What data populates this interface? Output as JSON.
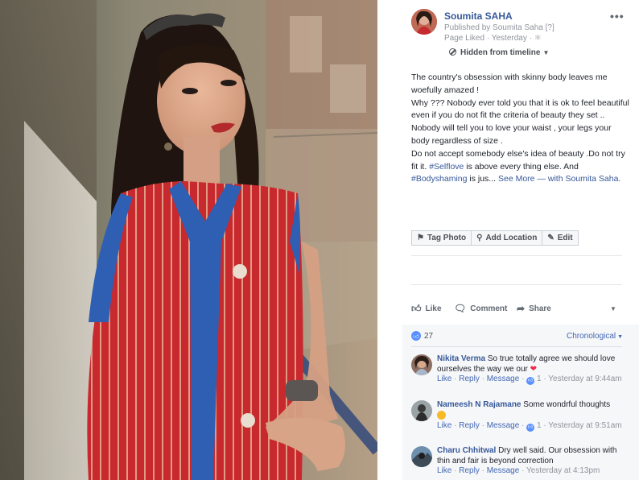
{
  "post": {
    "author": "Soumita SAHA",
    "published_by": "Published by Soumita Saha",
    "help_mark": "[?]",
    "liked_line": "Page Liked · Yesterday ·",
    "more": "•••",
    "visibility": "Hidden from timeline",
    "body": [
      "The country's obsession with skinny body leaves me woefully amazed !",
      "Why ??? Nobody ever told you that it is ok to feel beautiful even if you do not fit the criteria of beauty they set ..",
      "Nobody will tell you to love your waist , your legs your body regardless of size .",
      "Do not accept somebody else's idea of beauty .Do not try fit it."
    ],
    "hashtag_selflove": "#Selflove",
    "after_selflove": " is above every thing else. And ",
    "hashtag_bodyshaming": "#Bodyshaming",
    "after_bodyshaming": " is jus...",
    "see_more": "See More",
    "with_text": "— with",
    "tagged": "Soumita Saha."
  },
  "photo_actions": {
    "tag_photo": "Tag Photo",
    "add_location": "Add Location",
    "edit": "Edit"
  },
  "reactions": {
    "like": "Like",
    "comment": "Comment",
    "share": "Share"
  },
  "comments_section": {
    "like_count": "27",
    "sort": "Chronological",
    "items": [
      {
        "name": "Nikita Verma",
        "text": "So true totally agree we should love ourselves the way we our",
        "like": "Like",
        "reply": "Reply",
        "message": "Message",
        "likes": "1",
        "time": "Yesterday at 9:44am"
      },
      {
        "name": "Nameesh N Rajamane",
        "text": "Some wondrful thoughts",
        "like": "Like",
        "reply": "Reply",
        "message": "Message",
        "likes": "1",
        "time": "Yesterday at 9:51am"
      },
      {
        "name": "Charu Chhitwal",
        "text": "Dry well said. Our obsession with thin and fair is beyond correction",
        "like": "Like",
        "reply": "Reply",
        "message": "Message",
        "time": "Yesterday at 4:13pm"
      }
    ]
  },
  "colors": {
    "link": "#365899",
    "like_blue": "#5890ff",
    "dress_red": "#c72a2f",
    "dress_blue": "#2f5fb3"
  }
}
